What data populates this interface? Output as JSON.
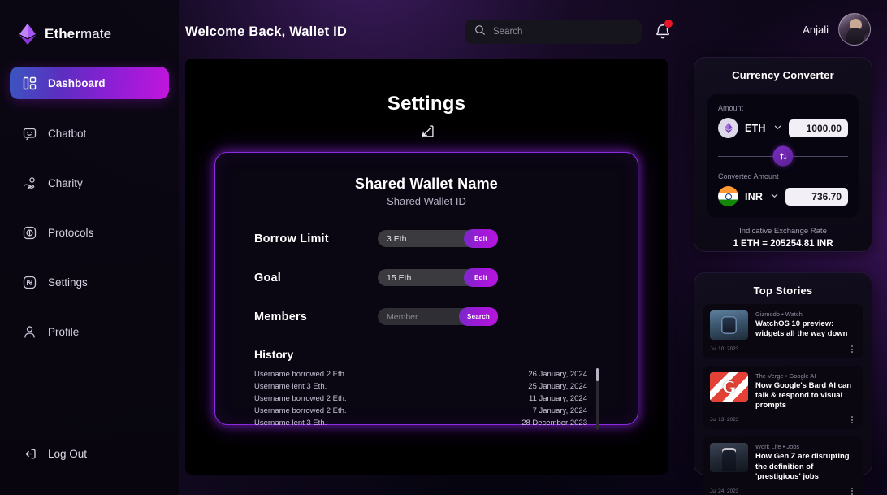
{
  "brand": {
    "name_bold": "Ether",
    "name_light": "mate",
    "logo_icon": "ethereum-diamond-icon"
  },
  "sidebar": {
    "items": [
      {
        "label": "Dashboard",
        "icon": "dashboard-icon",
        "active": true
      },
      {
        "label": "Chatbot",
        "icon": "chat-bubble-icon",
        "active": false
      },
      {
        "label": "Charity",
        "icon": "hand-coin-icon",
        "active": false
      },
      {
        "label": "Protocols",
        "icon": "protocol-circle-icon",
        "active": false
      },
      {
        "label": "Settings",
        "icon": "settings-square-icon",
        "active": false
      },
      {
        "label": "Profile",
        "icon": "person-icon",
        "active": false
      }
    ],
    "logout": {
      "label": "Log Out",
      "icon": "logout-arrow-icon"
    }
  },
  "header": {
    "welcome": "Welcome Back, Wallet ID",
    "search": {
      "placeholder": "Search",
      "icon": "search-icon"
    },
    "notifications": {
      "icon": "bell-icon",
      "has_badge": true,
      "badge_color": "#e8152b"
    },
    "user": {
      "name": "Anjali",
      "avatar_icon": "user-avatar"
    }
  },
  "main": {
    "title": "Settings",
    "title_icon": "arrow-into-box-icon",
    "wallet": {
      "name": "Shared Wallet Name",
      "id": "Shared Wallet ID",
      "rows": [
        {
          "label": "Borrow Limit",
          "value": "3 Eth",
          "is_placeholder": false,
          "button": "Edit"
        },
        {
          "label": "Goal",
          "value": "15 Eth",
          "is_placeholder": false,
          "button": "Edit"
        },
        {
          "label": "Members",
          "value": "Member",
          "is_placeholder": true,
          "button": "Search"
        }
      ],
      "history_title": "History",
      "history": [
        {
          "text": "Username borrowed 2 Eth.",
          "date": "26 January, 2024"
        },
        {
          "text": "Username lent 3 Eth.",
          "date": "25 January, 2024"
        },
        {
          "text": "Username borrowed 2 Eth.",
          "date": "11 January, 2024"
        },
        {
          "text": "Username borrowed 2 Eth.",
          "date": "7 January, 2024"
        },
        {
          "text": "Username lent 3 Eth.",
          "date": "28 December 2023"
        }
      ]
    }
  },
  "converter": {
    "title": "Currency Converter",
    "amount_label": "Amount",
    "from_currency": "ETH",
    "from_value": "1000.00",
    "converted_label": "Converted Amount",
    "to_currency": "INR",
    "to_value": "736.70",
    "swap_icon": "swap-vertical-icon",
    "rate_label": "Indicative Exchange Rate",
    "rate_value": "1 ETH = 205254.81 INR"
  },
  "stories": {
    "title": "Top Stories",
    "items": [
      {
        "source": "Gizmodo • Watch",
        "headline": "WatchOS 10 preview: widgets all the way down",
        "date": "Jul 10, 2023",
        "menu_icon": "kebab-menu-icon"
      },
      {
        "source": "The Verge • Google AI",
        "headline": "Now Google's Bard AI can talk & respond to visual prompts",
        "date": "Jul 13, 2023",
        "menu_icon": "kebab-menu-icon"
      },
      {
        "source": "Work Life • Jobs",
        "headline": "How Gen Z are disrupting the definition of 'prestigious' jobs",
        "date": "Jul 24, 2023",
        "menu_icon": "kebab-menu-icon"
      }
    ]
  },
  "theme": {
    "accent_purple": "#8a2be2",
    "accent_magenta": "#c215dd",
    "accent_blue": "#3a56c0",
    "badge_red": "#e8152b",
    "panel_bg": "#0a0612"
  }
}
